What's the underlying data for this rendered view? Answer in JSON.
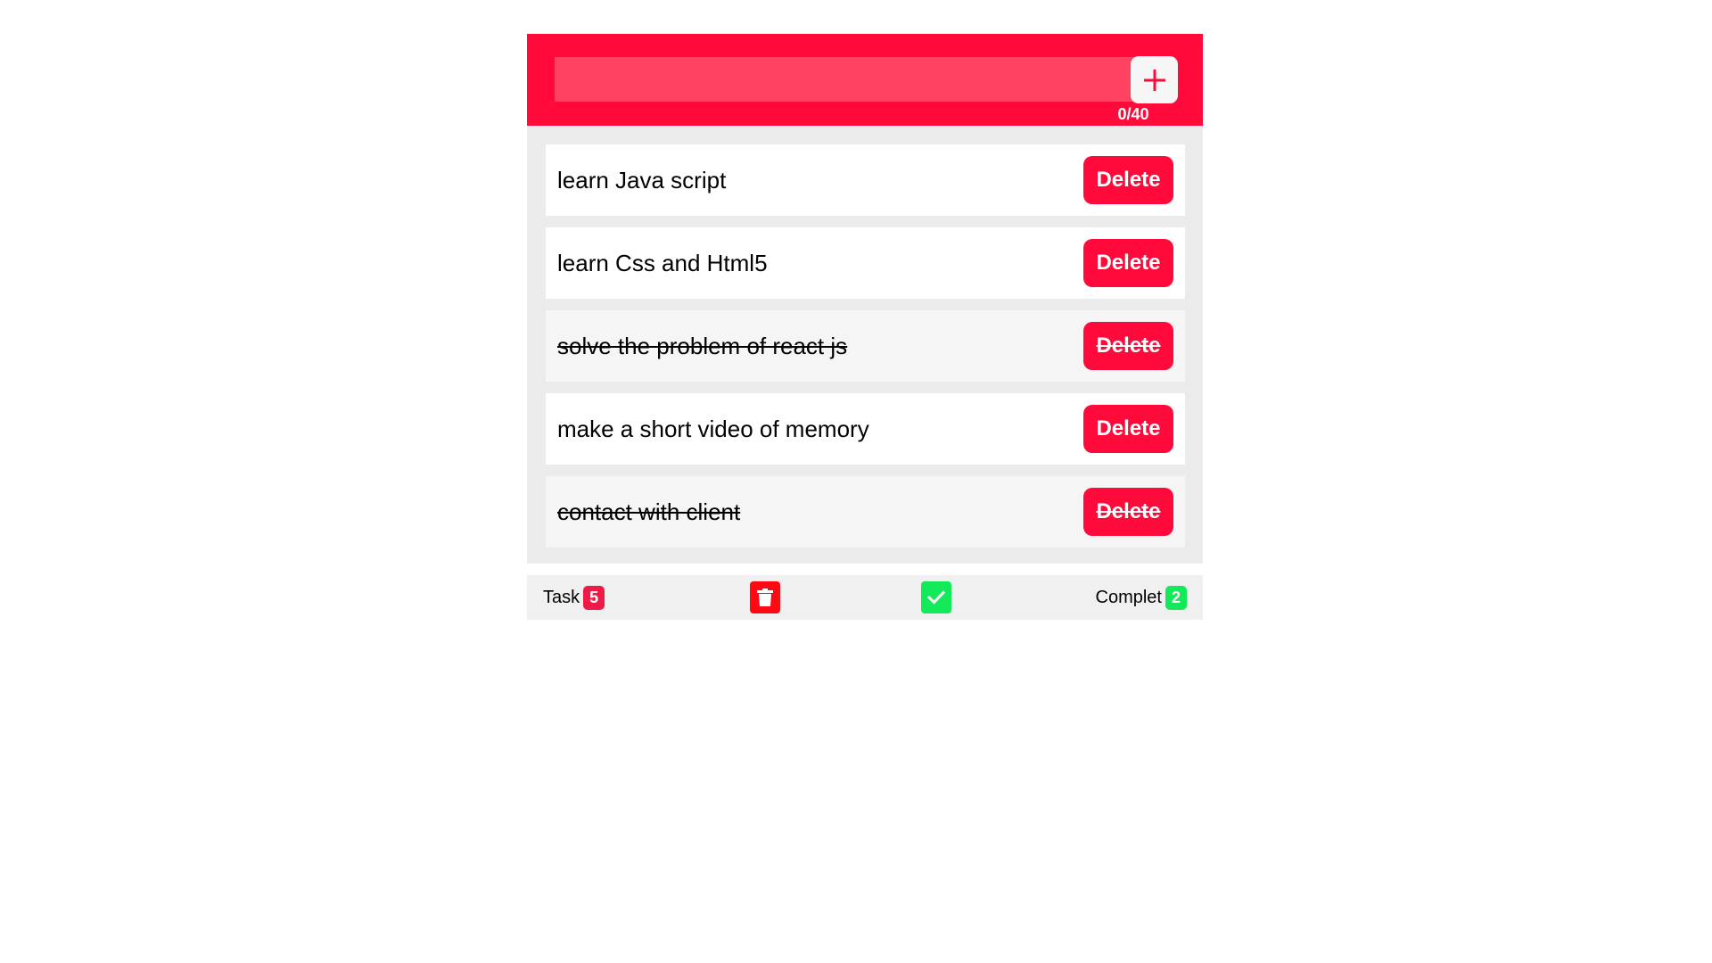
{
  "input": {
    "value": "",
    "placeholder": "",
    "counter": "0/40"
  },
  "tasks": [
    {
      "text": "learn Java script",
      "done": false,
      "delete_label": "Delete"
    },
    {
      "text": "learn Css and Html5",
      "done": false,
      "delete_label": "Delete"
    },
    {
      "text": "solve the problem of react js",
      "done": true,
      "delete_label": "Delete"
    },
    {
      "text": "make a short video of memory",
      "done": false,
      "delete_label": "Delete"
    },
    {
      "text": "contact with client",
      "done": true,
      "delete_label": "Delete"
    }
  ],
  "footer": {
    "task_label": "Task",
    "task_count": "5",
    "complete_label": "Complet",
    "complete_count": "2",
    "clear_icon": "trash-icon",
    "complete_icon": "checkmark-icon"
  },
  "colors": {
    "accent": "#ff0a3b",
    "input_bg": "#ff4360",
    "success": "#12ea5a",
    "danger": "#ff0a14"
  }
}
